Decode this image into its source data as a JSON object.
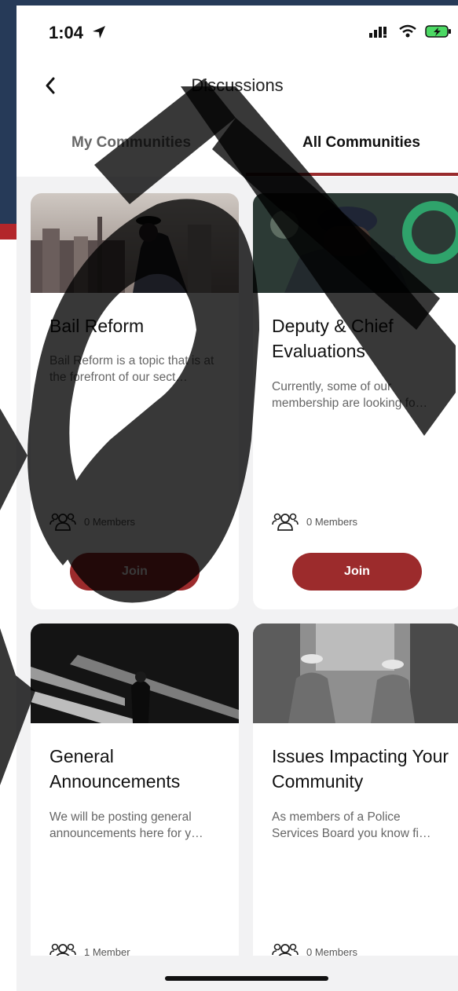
{
  "status_bar": {
    "time": "1:04"
  },
  "header": {
    "title": "Discussions"
  },
  "tabs": [
    {
      "label": "My Communities"
    },
    {
      "label": "All Communities"
    }
  ],
  "communities": [
    {
      "title": "Bail Reform",
      "description": "Bail Reform is a topic that is at the forefront of our sect…",
      "members": "0 Members",
      "join_label": "Join"
    },
    {
      "title": "Deputy & Chief Evaluations",
      "description": "Currently, some of our membership are looking fo…",
      "members": "0 Members",
      "join_label": "Join"
    },
    {
      "title": "General Announcements",
      "description": "We will be posting general announcements here for y…",
      "members": "1 Member"
    },
    {
      "title": "Issues Impacting Your Community",
      "description": "As members of a Police Services Board you know fi…",
      "members": "0 Members"
    }
  ],
  "colors": {
    "accent": "#9c2b2c",
    "navy": "#263a58"
  }
}
